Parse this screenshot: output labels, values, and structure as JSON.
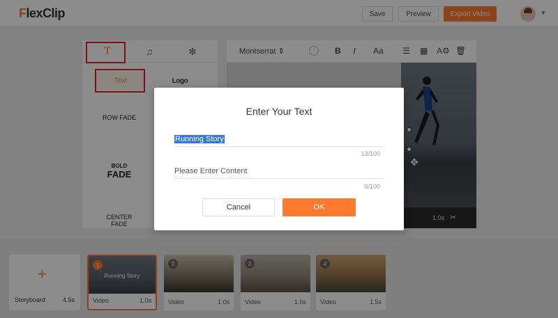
{
  "app": {
    "logo_prefix": "F",
    "logo_rest": "lexClip",
    "save_label": "Save",
    "preview_label": "Preview",
    "export_label": "Export Video",
    "accent_color": "#ff7a2f"
  },
  "left_panel": {
    "tabs": [
      {
        "label": "T",
        "icon": "text-icon",
        "active": true
      },
      {
        "label": "♫",
        "icon": "music-icon",
        "active": false
      },
      {
        "label": "✻",
        "icon": "effect-icon",
        "active": false
      }
    ],
    "subtabs": [
      "Text",
      "Logo"
    ],
    "styles": [
      {
        "line1": "ROW FADE",
        "line2": ""
      },
      {
        "line1": "BOLD",
        "line2": "FADE"
      },
      {
        "line1": "CENTER",
        "line2": "FADE"
      }
    ]
  },
  "toolbar": {
    "font_name": "Montserrat",
    "icons": [
      "color-swatch-icon",
      "bold-icon",
      "italic-icon",
      "font-size-icon",
      "align-icon",
      "grid-icon",
      "text-effect-icon",
      "trash-icon"
    ]
  },
  "preview": {
    "duration": "1.0s"
  },
  "storyboard": {
    "label": "Storyboard",
    "duration": "4.5s",
    "clips": [
      {
        "num": "1",
        "caption": "Running Story",
        "type": "Video",
        "duration": "1.0s"
      },
      {
        "num": "2",
        "caption": "",
        "type": "Video",
        "duration": "1.0s"
      },
      {
        "num": "3",
        "caption": "",
        "type": "Video",
        "duration": "1.0s"
      },
      {
        "num": "4",
        "caption": "",
        "type": "Video",
        "duration": "1.5s"
      }
    ]
  },
  "modal": {
    "title": "Enter Your Text",
    "title_value": "Running Story",
    "title_counter": "13/100",
    "content_placeholder": "Please Enter Content",
    "content_counter": "0/100",
    "cancel_label": "Cancel",
    "ok_label": "OK"
  }
}
